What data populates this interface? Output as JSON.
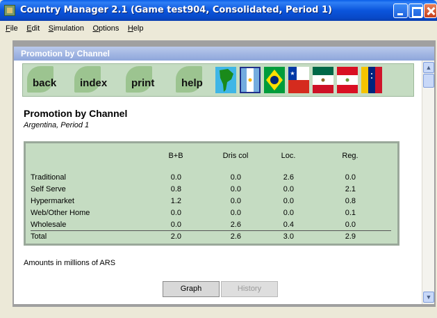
{
  "window": {
    "title": "Country Manager 2.1 (Game test904, Consolidated, Period 1)"
  },
  "menu": [
    {
      "accel": "F",
      "rest": "ile"
    },
    {
      "accel": "E",
      "rest": "dit"
    },
    {
      "accel": "S",
      "rest": "imulation"
    },
    {
      "accel": "O",
      "rest": "ptions"
    },
    {
      "accel": "H",
      "rest": "elp"
    }
  ],
  "pane": {
    "header": "Promotion by Channel"
  },
  "toolbar": {
    "back": "back",
    "index": "index",
    "print": "print",
    "help": "help",
    "flags": [
      "south-america-map",
      "argentina-flag",
      "brazil-flag",
      "chile-flag",
      "mexico-flag",
      "peru-flag",
      "venezuela-flag"
    ]
  },
  "report": {
    "title": "Promotion by Channel",
    "subtitle": "Argentina, Period 1",
    "columns": [
      "B+B",
      "Dris col",
      "Loc.",
      "Reg."
    ],
    "rows": [
      {
        "label": "Traditional",
        "values": [
          "0.0",
          "0.0",
          "2.6",
          "0.0"
        ]
      },
      {
        "label": "Self Serve",
        "values": [
          "0.8",
          "0.0",
          "0.0",
          "2.1"
        ]
      },
      {
        "label": "Hypermarket",
        "values": [
          "1.2",
          "0.0",
          "0.0",
          "0.8"
        ]
      },
      {
        "label": "Web/Other Home",
        "values": [
          "0.0",
          "0.0",
          "0.0",
          "0.1"
        ]
      },
      {
        "label": "Wholesale",
        "values": [
          "0.0",
          "2.6",
          "0.4",
          "0.0"
        ]
      },
      {
        "label": "Total",
        "values": [
          "2.0",
          "2.6",
          "3.0",
          "2.9"
        ]
      }
    ],
    "note": "Amounts in millions of ARS"
  },
  "buttons": {
    "graph": "Graph",
    "history": "History"
  },
  "colors": {
    "panel_green": "#c5dcc2",
    "titlebar_blue": "#0b55dc",
    "leaf_green": "#9cc490"
  }
}
